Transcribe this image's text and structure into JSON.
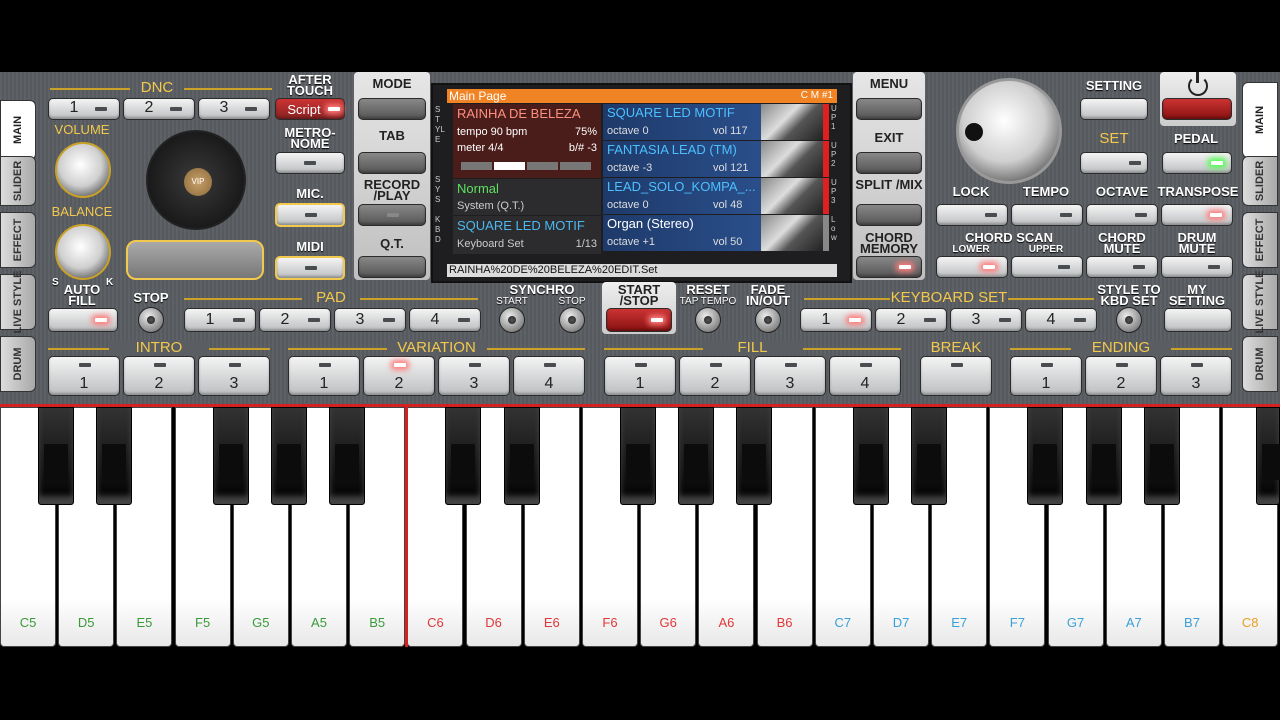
{
  "tabs_left": [
    "MAIN",
    "SLIDER",
    "EFFECT",
    "LIVE STYLE",
    "DRUM"
  ],
  "tabs_right": [
    "MAIN",
    "SLIDER",
    "EFFECT",
    "LIVE STYLE",
    "DRUM"
  ],
  "dnc": {
    "label": "DNC",
    "buttons": [
      "1",
      "2",
      "3"
    ],
    "aftertouch": "AFTER TOUCH",
    "script": "Script"
  },
  "volume": "VOLUME",
  "balance": "BALANCE",
  "balance_s": "S",
  "balance_k": "K",
  "metronome": "METRO- NOME",
  "mic": "MIC.",
  "midi": "MIDI",
  "mode": "MODE",
  "tab": "TAB",
  "record": "RECORD /PLAY",
  "qt": "Q.T.",
  "menu": "MENU",
  "exit": "EXIT",
  "split": "SPLIT /MIX",
  "chord_memory": "CHORD MEMORY",
  "logo": "VIP",
  "screen": {
    "title": "Main Page",
    "cm": "C M #1",
    "style_name": "RAINHA DE BELEZA",
    "tempo": "tempo 90 bpm",
    "pct": "75%",
    "meter": "meter 4/4",
    "key": "b/# -3",
    "style_label": "STYLE",
    "normal": "Normal",
    "system": "System (Q.T.)",
    "sys_label": "SYS",
    "kbd_name": "SQUARE LED MOTIF",
    "kbd_set": "Keyboard Set",
    "kbd_count": "1/13",
    "kbd_label": "KBD",
    "voices": [
      {
        "name": "SQUARE LED MOTIF",
        "octave": "octave  0",
        "vol": "vol 117",
        "tag": "UP 1"
      },
      {
        "name": "FANTASIA LEAD (TM)",
        "octave": "octave -3",
        "vol": "vol 121",
        "tag": "UP 2"
      },
      {
        "name": "LEAD_SOLO_KOMPA_...",
        "octave": "octave  0",
        "vol": "vol 48",
        "tag": "UP 3"
      },
      {
        "name": "Organ (Stereo)",
        "octave": "octave +1",
        "vol": "vol 50",
        "tag": "Low"
      }
    ],
    "file": "RAINHA%20DE%20BELEZA%20EDIT.Set"
  },
  "setting": "SETTING",
  "set": "SET",
  "pedal": "PEDAL",
  "lock": "LOCK",
  "tempo": "TEMPO",
  "octave": "OCTAVE",
  "transpose": "TRANSPOSE",
  "chord_scan": "CHORD SCAN",
  "lower": "LOWER",
  "upper": "UPPER",
  "chord_mute": "CHORD MUTE",
  "drum_mute": "DRUM MUTE",
  "auto_fill": "AUTO FILL",
  "stop": "STOP",
  "pad": "PAD",
  "pad_buttons": [
    "1",
    "2",
    "3",
    "4"
  ],
  "synchro": "SYNCHRO",
  "sync_start": "START",
  "sync_stop": "STOP",
  "start_stop": "START /STOP",
  "reset": "RESET",
  "tap_tempo": "TAP TEMPO",
  "fade": "FADE IN/OUT",
  "keyboard_set": "KEYBOARD SET",
  "kbd_buttons": [
    "1",
    "2",
    "3",
    "4"
  ],
  "style_to_kbd": "STYLE TO KBD SET",
  "my_setting": "MY SETTING",
  "intro": "INTRO",
  "intro_buttons": [
    "1",
    "2",
    "3"
  ],
  "variation": "VARIATION",
  "variation_buttons": [
    "1",
    "2",
    "3",
    "4"
  ],
  "fill": "FILL",
  "fill_buttons": [
    "1",
    "2",
    "3",
    "4"
  ],
  "break": "BREAK",
  "ending": "ENDING",
  "ending_buttons": [
    "1",
    "2",
    "3"
  ],
  "notes": [
    "C5",
    "D5",
    "E5",
    "F5",
    "G5",
    "A5",
    "B5",
    "C6",
    "D6",
    "E6",
    "F6",
    "G6",
    "A6",
    "B6",
    "C7",
    "D7",
    "E7",
    "F7",
    "G7",
    "A7",
    "B7",
    "C8"
  ],
  "colors": {
    "green": "#3a9a3a",
    "red": "#e03838",
    "blue": "#3aa0d8",
    "orange": "#e8a020",
    "accent": "#f2c94c"
  }
}
